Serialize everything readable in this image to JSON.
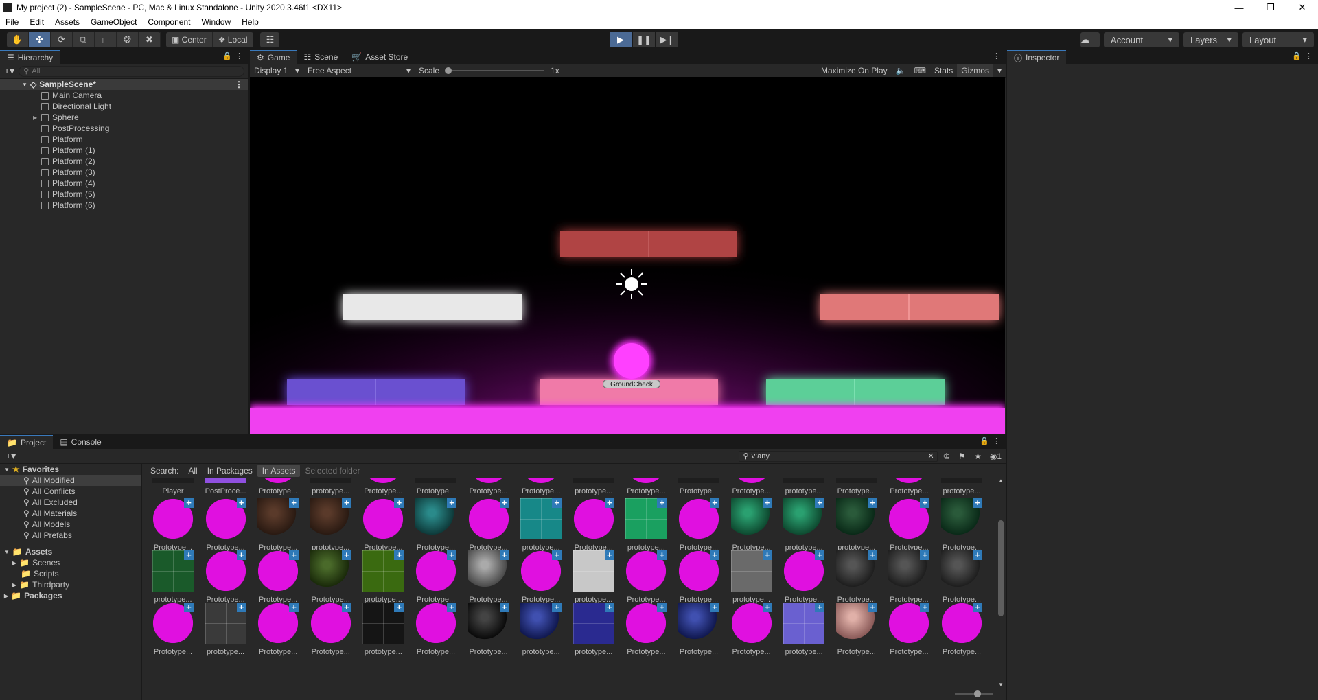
{
  "window": {
    "title": "My project (2) - SampleScene - PC, Mac & Linux Standalone - Unity 2020.3.46f1 <DX11>"
  },
  "menu": [
    "File",
    "Edit",
    "Assets",
    "GameObject",
    "Component",
    "Window",
    "Help"
  ],
  "toolbar": {
    "pivot_center": "Center",
    "pivot_local": "Local",
    "account": "Account",
    "layers": "Layers",
    "layout": "Layout"
  },
  "hierarchy": {
    "tab": "Hierarchy",
    "search_placeholder": "All",
    "scene": "SampleScene*",
    "items": [
      "Main Camera",
      "Directional Light",
      "Sphere",
      "PostProcessing",
      "Platform",
      "Platform (1)",
      "Platform (2)",
      "Platform (3)",
      "Platform (4)",
      "Platform (5)",
      "Platform (6)"
    ]
  },
  "center_tabs": [
    "Game",
    "Scene",
    "Asset Store"
  ],
  "game_bar": {
    "display": "Display 1",
    "aspect": "Free Aspect",
    "scale_label": "Scale",
    "scale_value": "1x",
    "maximize": "Maximize On Play",
    "stats": "Stats",
    "gizmos": "Gizmos"
  },
  "game_view": {
    "ground_check_label": "GroundCheck"
  },
  "inspector": {
    "tab": "Inspector"
  },
  "project": {
    "tabs": [
      "Project",
      "Console"
    ],
    "search_value": "v:any",
    "search_bar": {
      "label": "Search:",
      "all": "All",
      "in_packages": "In Packages",
      "in_assets": "In Assets",
      "selected_folder": "Selected folder"
    },
    "favorites_label": "Favorites",
    "favorites": [
      "All Modified",
      "All Conflicts",
      "All Excluded",
      "All Materials",
      "All Models",
      "All Prefabs"
    ],
    "assets_label": "Assets",
    "asset_folders": [
      "Scenes",
      "Scripts",
      "Thirdparty"
    ],
    "packages_label": "Packages",
    "hidden_count": "1",
    "row0_labels": [
      "Player",
      "PostProce...",
      "Prototype...",
      "prototype...",
      "Prototype...",
      "Prototype...",
      "Prototype...",
      "Prototype...",
      "prototype...",
      "Prototype...",
      "Prototype...",
      "Prototype...",
      "prototype...",
      "Prototype...",
      "Prototype...",
      "prototype..."
    ],
    "row1_labels": [
      "Prototype...",
      "Prototype...",
      "Prototype...",
      "prototype...",
      "Prototype...",
      "Prototype...",
      "Prototype...",
      "prototype...",
      "Prototype...",
      "prototype...",
      "Prototype...",
      "Prototype...",
      "prototype...",
      "prototype...",
      "Prototype...",
      "Prototype..."
    ],
    "row2_labels": [
      "prototype...",
      "Prototype...",
      "Prototype...",
      "Prototype...",
      "prototype...",
      "Prototype...",
      "Prototype...",
      "Prototype...",
      "prototype...",
      "Prototype...",
      "Prototype...",
      "prototype...",
      "Prototype...",
      "Prototype...",
      "Prototype...",
      "Prototype..."
    ],
    "row3_labels": [
      "Prototype...",
      "prototype...",
      "Prototype...",
      "Prototype...",
      "prototype...",
      "Prototype...",
      "Prototype...",
      "prototype...",
      "prototype...",
      "Prototype...",
      "Prototype...",
      "Prototype...",
      "prototype...",
      "Prototype...",
      "Prototype...",
      "Prototype..."
    ]
  },
  "colors": {
    "accent": "#3a79bb",
    "magenta": "#e010e0"
  }
}
